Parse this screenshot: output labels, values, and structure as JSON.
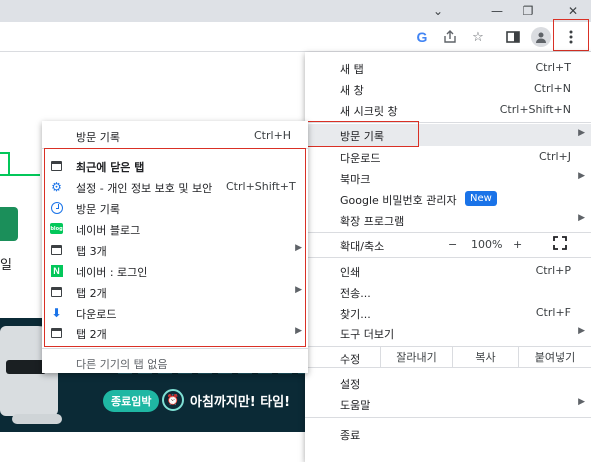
{
  "window": {
    "minimize_icon": "chevron-down",
    "maximize_icon": "restore",
    "close_icon": "close"
  },
  "toolbar": {
    "icons": [
      "google-icon",
      "share-icon",
      "star-icon",
      "sidebar-icon",
      "profile-icon",
      "kebab-menu-icon"
    ],
    "google_letter": "G"
  },
  "page": {
    "partial_text": "일",
    "banner": {
      "pill": "종료임박",
      "headline": "아침까지만! 타임!"
    }
  },
  "main_menu": {
    "items": {
      "new_tab": {
        "label": "새 탭",
        "shortcut": "Ctrl+T"
      },
      "new_window": {
        "label": "새 창",
        "shortcut": "Ctrl+N"
      },
      "incognito": {
        "label": "새 시크릿 창",
        "shortcut": "Ctrl+Shift+N"
      },
      "history": {
        "label": "방문 기록"
      },
      "downloads": {
        "label": "다운로드",
        "shortcut": "Ctrl+J"
      },
      "bookmarks": {
        "label": "북마크"
      },
      "password_manager": {
        "label": "Google 비밀번호 관리자",
        "badge": "New"
      },
      "extensions": {
        "label": "확장 프로그램"
      },
      "zoom": {
        "label": "확대/축소",
        "minus": "−",
        "level": "100%",
        "plus": "+"
      },
      "print": {
        "label": "인쇄",
        "shortcut": "Ctrl+P"
      },
      "cast": {
        "label": "전송..."
      },
      "find": {
        "label": "찾기...",
        "shortcut": "Ctrl+F"
      },
      "more_tools": {
        "label": "도구 더보기"
      },
      "edit": {
        "label": "수정",
        "cut": "잘라내기",
        "copy": "복사",
        "paste": "붙여넣기"
      },
      "settings": {
        "label": "설정"
      },
      "help": {
        "label": "도움말"
      },
      "exit": {
        "label": "종료"
      }
    }
  },
  "history_submenu": {
    "header": {
      "label": "방문 기록",
      "shortcut": "Ctrl+H"
    },
    "recently_closed": {
      "label": "최근에 닫은 탭"
    },
    "items": [
      {
        "label": "설정 - 개인 정보 보호 및 보안",
        "shortcut": "Ctrl+Shift+T",
        "icon": "gear-icon"
      },
      {
        "label": "방문 기록",
        "icon": "history-icon"
      },
      {
        "label": "네이버 블로그",
        "icon": "naver-blog-icon"
      },
      {
        "label": "탭 3개",
        "icon": "tab-icon",
        "submenu": true
      },
      {
        "label": "네이버 : 로그인",
        "icon": "naver-icon"
      },
      {
        "label": "탭 2개",
        "icon": "tab-icon",
        "submenu": true
      },
      {
        "label": "다운로드",
        "icon": "download-icon"
      },
      {
        "label": "탭 2개",
        "icon": "tab-icon",
        "submenu": true
      }
    ],
    "footer": {
      "label": "다른 기기의 탭 없음"
    }
  },
  "colors": {
    "highlight_box": "#d93025",
    "accent": "#1a73e8",
    "naver_green": "#03c75a",
    "hover_bg": "#e8eaed"
  }
}
